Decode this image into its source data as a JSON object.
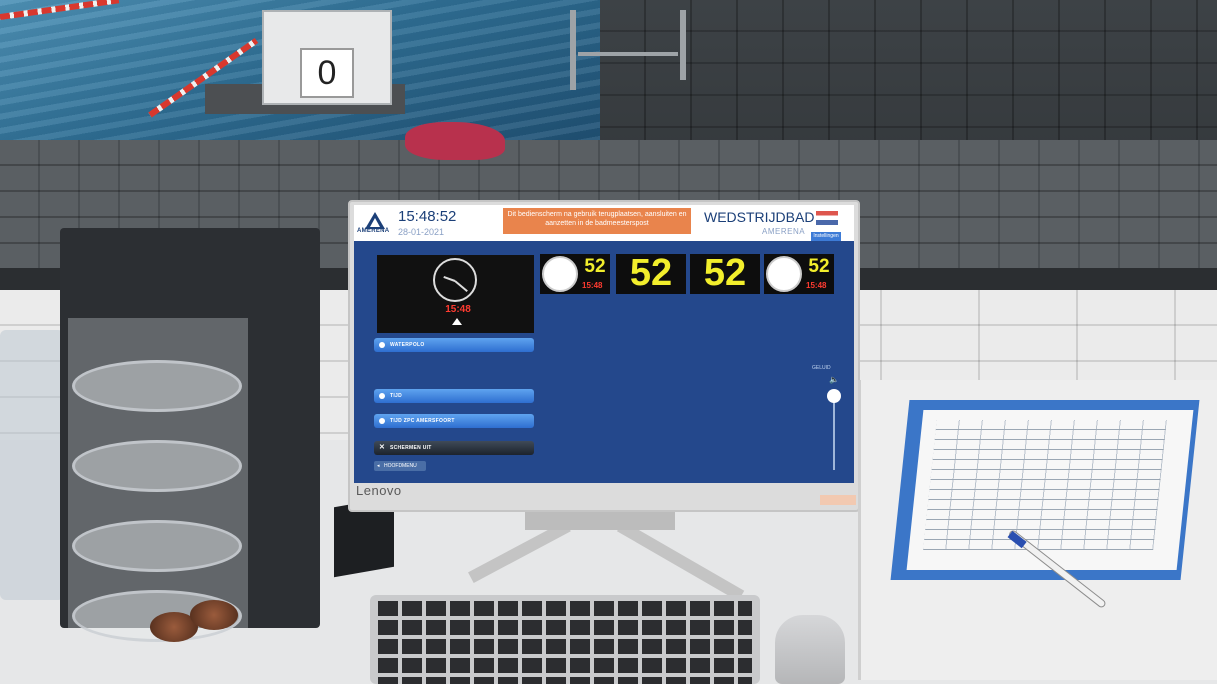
{
  "scene": {
    "start_block_number": "0",
    "monitor_brand": "Lenovo"
  },
  "ui": {
    "header": {
      "logo_text": "AMERENA",
      "time": "15:48:52",
      "date": "28-01-2021",
      "notice": "Dit bedienscherm na gebruik terugplaatsen, aansluiten en aanzetten in de badmeesterspost",
      "venue": "WEDSTRIJDBAD",
      "venue_sub": "AMERENA",
      "mini_button": "Instellingen"
    },
    "preview": {
      "time": "15:48",
      "brand": "AMERENA"
    },
    "menu": {
      "items": [
        {
          "label": "WATERPOLO",
          "style": "blue"
        },
        {
          "label": "TIJD",
          "style": "blue"
        },
        {
          "label": "TIJD ZPC AMERSFOORT",
          "style": "blue"
        },
        {
          "label": "SCHERMEN UIT",
          "style": "dark"
        }
      ],
      "back_label": "HOOFDMENU"
    },
    "tiles": {
      "left_clock": {
        "value": "52",
        "time": "15:48"
      },
      "big_1": "52",
      "big_2": "52",
      "right_clock": {
        "value": "52",
        "time": "15:48"
      }
    },
    "volume": {
      "label": "GELUID",
      "level": 1.0
    },
    "colors": {
      "screen_bg": "#24488c",
      "notice_bg": "#e9844c",
      "digit_yellow": "#f2ee2c",
      "digit_red": "#ff3b30"
    }
  }
}
